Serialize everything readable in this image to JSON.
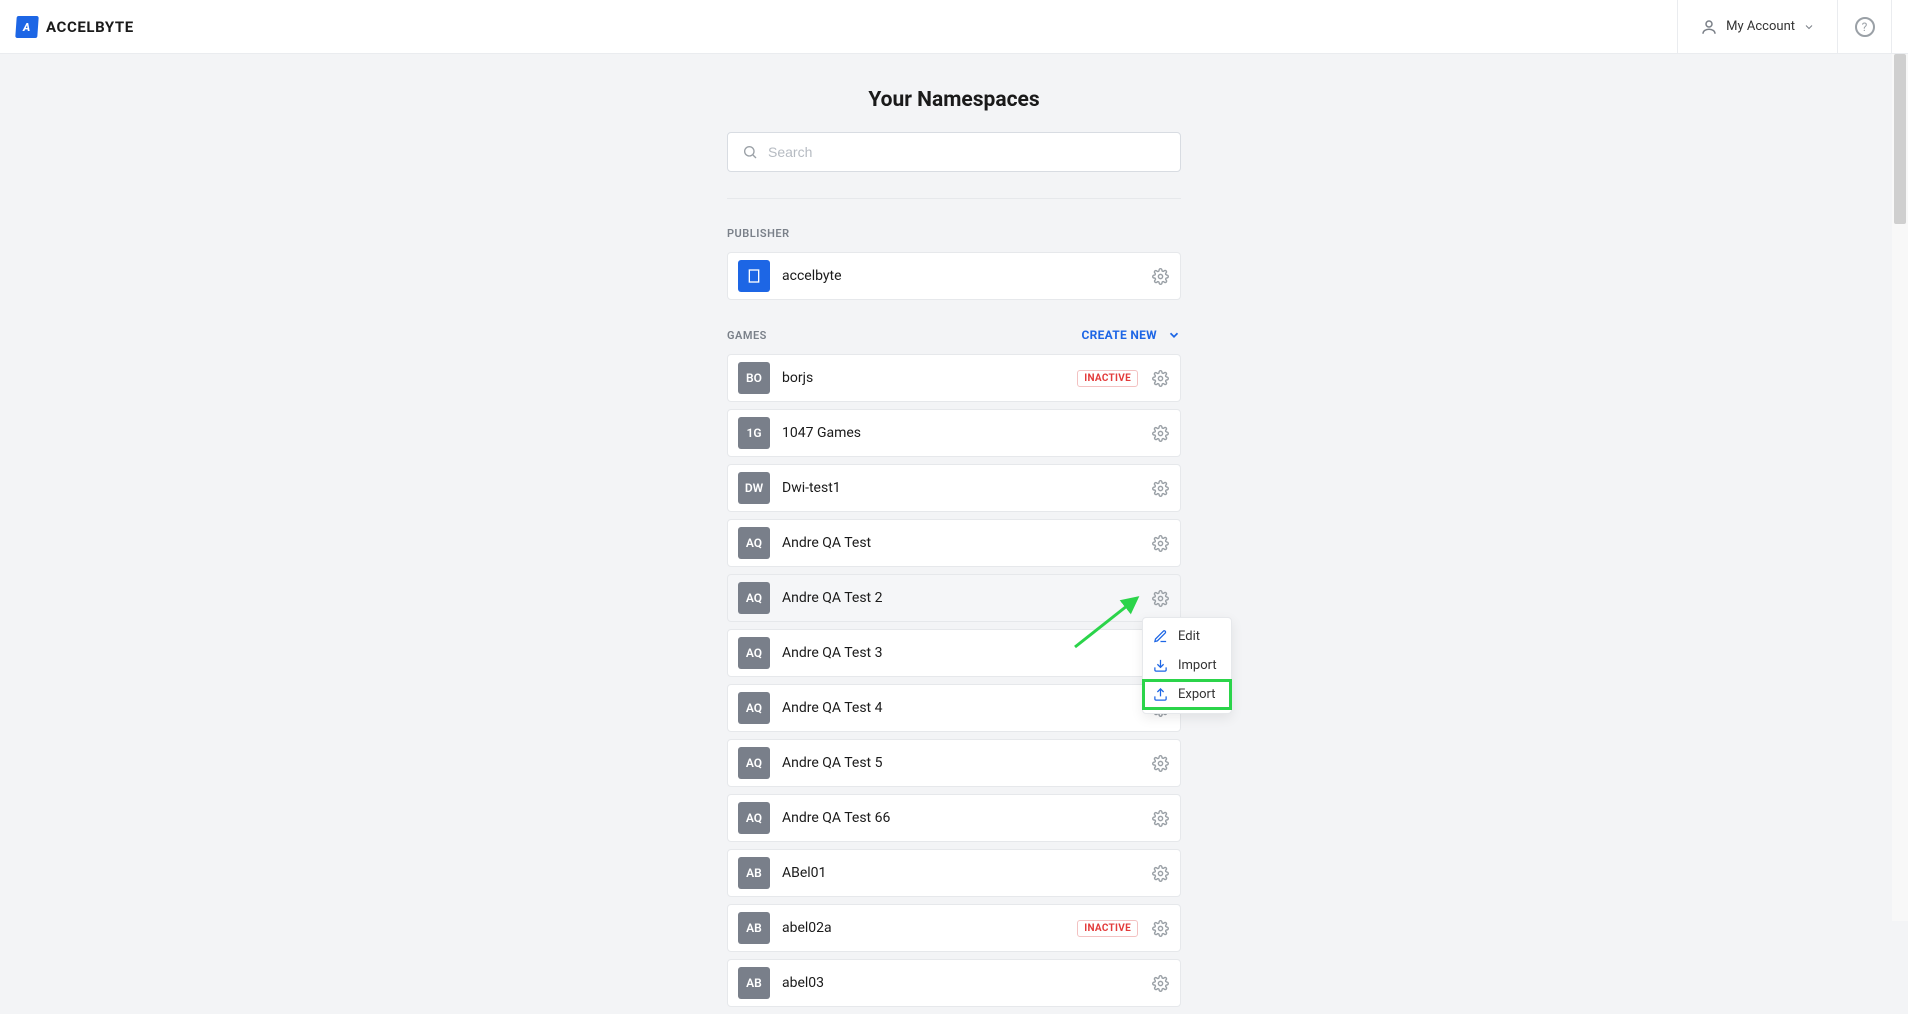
{
  "header": {
    "brand": "ACCELBYTE",
    "account_label": "My Account"
  },
  "page": {
    "title": "Your Namespaces",
    "search_placeholder": "Search"
  },
  "sections": {
    "publisher_label": "PUBLISHER",
    "games_label": "GAMES",
    "create_new_label": "CREATE NEW"
  },
  "publisher": {
    "name": "accelbyte",
    "avatar_initials": ""
  },
  "inactive_label": "INACTIVE",
  "games": [
    {
      "initials": "BO",
      "name": "borjs",
      "inactive": true
    },
    {
      "initials": "1G",
      "name": "1047 Games",
      "inactive": false
    },
    {
      "initials": "DW",
      "name": "Dwi-test1",
      "inactive": false
    },
    {
      "initials": "AQ",
      "name": "Andre QA Test",
      "inactive": false
    },
    {
      "initials": "AQ",
      "name": "Andre QA Test 2",
      "inactive": false,
      "active_row": true,
      "menu_open": true
    },
    {
      "initials": "AQ",
      "name": "Andre QA Test 3",
      "inactive": false
    },
    {
      "initials": "AQ",
      "name": "Andre QA Test 4",
      "inactive": false
    },
    {
      "initials": "AQ",
      "name": "Andre QA Test 5",
      "inactive": false
    },
    {
      "initials": "AQ",
      "name": "Andre QA Test 66",
      "inactive": false
    },
    {
      "initials": "AB",
      "name": "ABel01",
      "inactive": false
    },
    {
      "initials": "AB",
      "name": "abel02a",
      "inactive": true
    },
    {
      "initials": "AB",
      "name": "abel03",
      "inactive": false
    }
  ],
  "menu": {
    "edit": "Edit",
    "import": "Import",
    "export": "Export"
  }
}
